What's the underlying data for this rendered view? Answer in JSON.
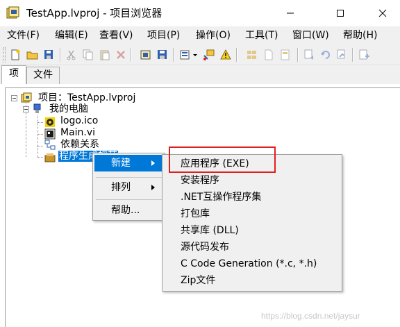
{
  "window": {
    "title": "TestApp.lvproj - 项目浏览器",
    "icon": "labview-project-icon",
    "controls": [
      "minimize-icon",
      "maximize-icon",
      "close-icon"
    ]
  },
  "menubar": {
    "items": [
      "文件(F)",
      "编辑(E)",
      "查看(V)",
      "项目(P)",
      "操作(O)",
      "工具(T)",
      "窗口(W)",
      "帮助(H)"
    ]
  },
  "toolbar": {
    "icons": [
      "new-icon",
      "open-icon",
      "save-all-icon",
      "cut-icon",
      "copy-icon",
      "paste-icon",
      "delete-icon",
      "build-icon",
      "save-icon",
      "view-options-icon",
      "dropdown-icon",
      "resolve-icon",
      "warning-icon",
      "library-icon",
      "file-icon",
      "refresh-icon",
      "expand-icon",
      "collapse-icon",
      "add-icon"
    ]
  },
  "tabs": [
    "项",
    "文件"
  ],
  "tree": {
    "root": "项目：TestApp.lvproj",
    "computer": "我的电脑",
    "children": [
      "logo.ico",
      "Main.vi",
      "依赖关系",
      "程序生成规范"
    ],
    "selected_visible": "程序生成规范"
  },
  "context_menu": {
    "items": [
      {
        "label": "新建",
        "has_submenu": true,
        "highlighted": true
      },
      {
        "label": "排列",
        "has_submenu": true,
        "highlighted": false
      },
      {
        "label": "帮助...",
        "has_submenu": false,
        "highlighted": false
      }
    ]
  },
  "submenu": {
    "items": [
      "应用程序 (EXE)",
      "安装程序",
      ".NET互操作程序集",
      "打包库",
      "共享库 (DLL)",
      "源代码发布",
      "C Code Generation (*.c, *.h)",
      "Zip文件"
    ],
    "annotated_item": "应用程序 (EXE)"
  },
  "colors": {
    "selection": "#0078d7",
    "annotation": "#e02020",
    "menu_bg": "#f0f0f0"
  },
  "watermark": "https://blog.csdn.net/jaysur"
}
